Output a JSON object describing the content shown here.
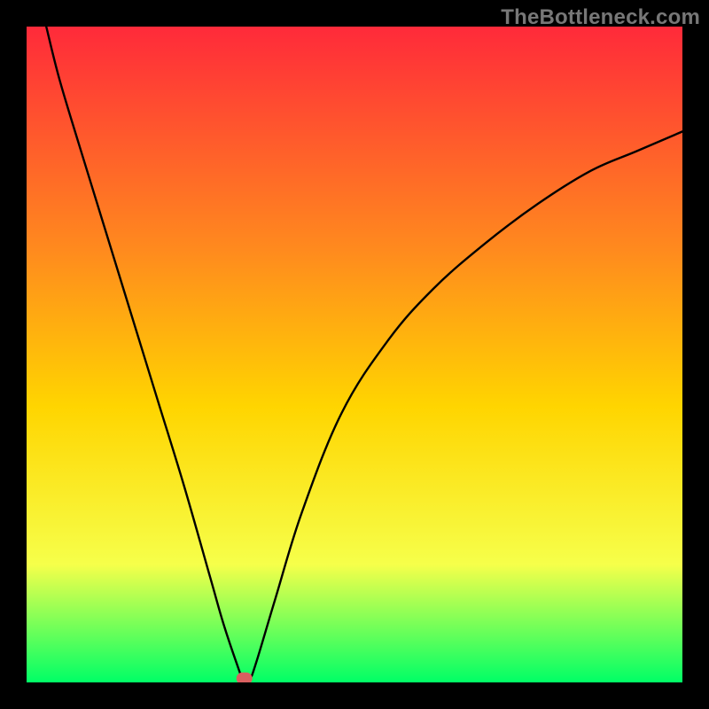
{
  "watermark": "TheBottleneck.com",
  "chart_data": {
    "type": "line",
    "title": "",
    "xlabel": "",
    "ylabel": "",
    "xlim": [
      0,
      100
    ],
    "ylim": [
      0,
      100
    ],
    "grid": false,
    "legend": false,
    "background_gradient": {
      "top_color": "#ff2a3a",
      "mid_upper_color": "#ff8a1e",
      "mid_color": "#ffd500",
      "mid_lower_color": "#f6ff4a",
      "bottom_color": "#00ff66"
    },
    "series": [
      {
        "name": "bottleneck-curve",
        "color": "#000000",
        "x": [
          3,
          5,
          8,
          12,
          16,
          20,
          24,
          28,
          30,
          32,
          33,
          34,
          35,
          38,
          42,
          48,
          55,
          62,
          70,
          78,
          86,
          93,
          100
        ],
        "y": [
          100,
          92,
          82,
          69,
          56,
          43,
          30,
          16,
          9,
          3,
          0.5,
          0.5,
          3,
          13,
          26,
          41,
          52,
          60,
          67,
          73,
          78,
          81,
          84
        ]
      }
    ],
    "markers": [
      {
        "name": "min-marker",
        "x": 33.2,
        "y": 0.6,
        "color": "#d96060",
        "size": 18,
        "shape": "rounded-rect"
      }
    ]
  }
}
